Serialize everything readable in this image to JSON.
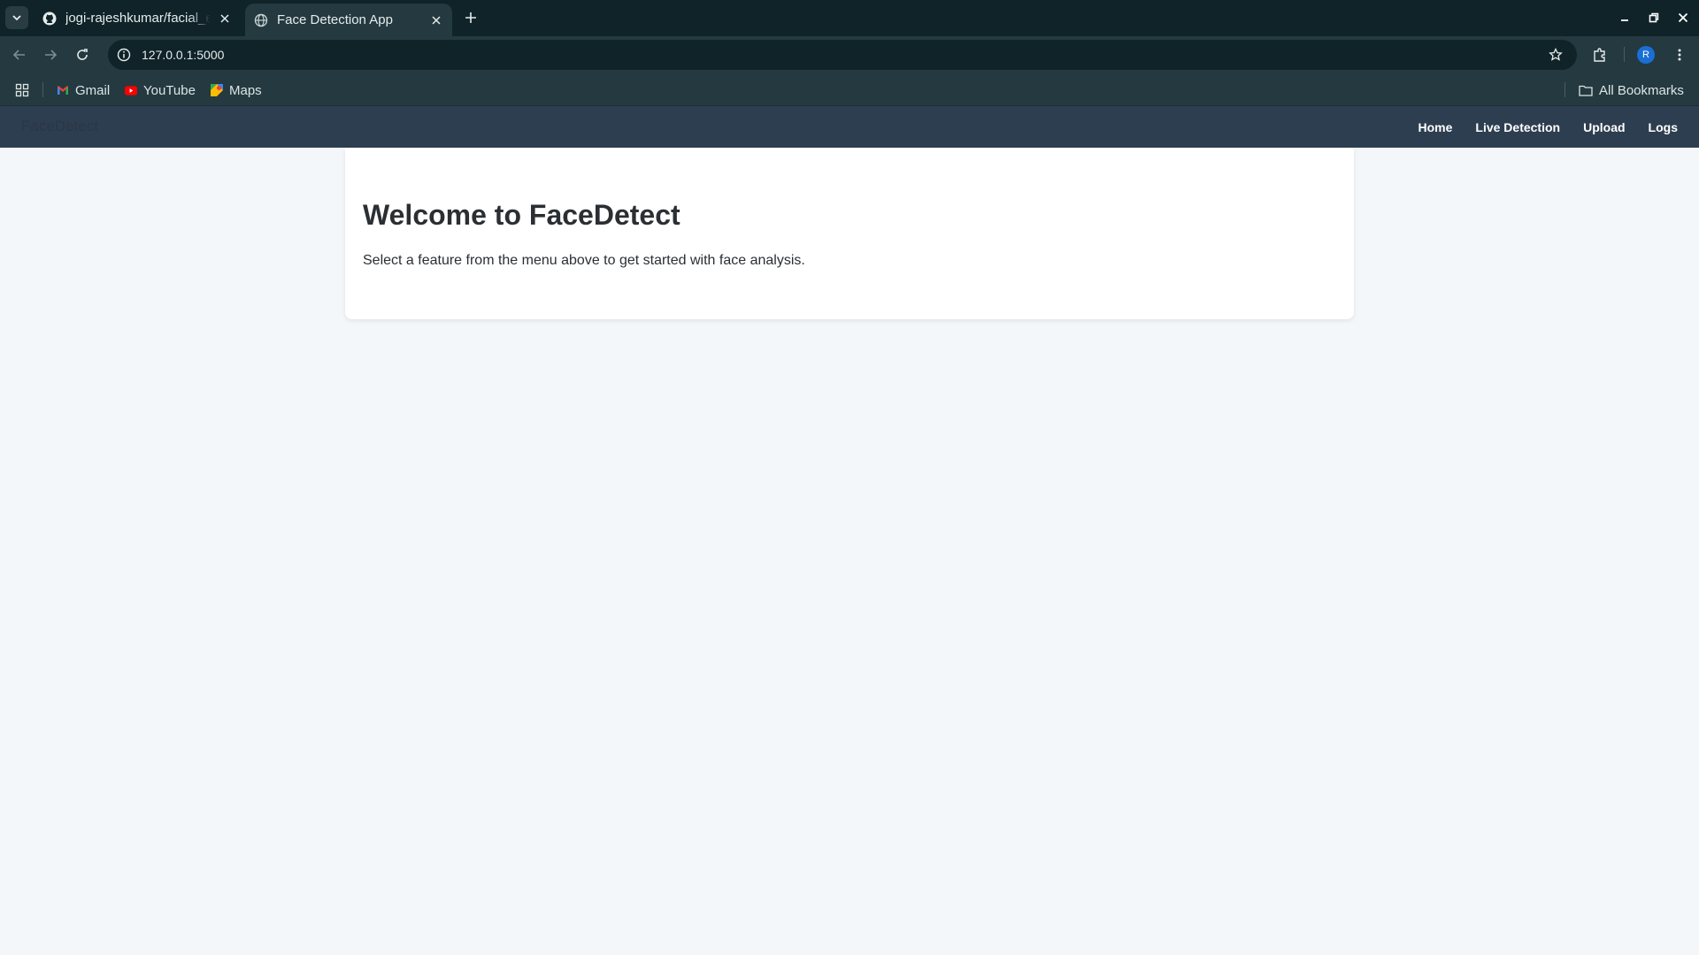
{
  "browser": {
    "tabs": [
      {
        "title": "jogi-rajeshkumar/facial_e",
        "icon": "github-icon"
      },
      {
        "title": "Face Detection App",
        "icon": "globe-icon"
      }
    ],
    "url": "127.0.0.1:5000",
    "profile_initial": "R",
    "bookmarks": [
      {
        "label": "Gmail",
        "icon": "gmail-icon"
      },
      {
        "label": "YouTube",
        "icon": "youtube-icon"
      },
      {
        "label": "Maps",
        "icon": "maps-icon"
      }
    ],
    "all_bookmarks_label": "All Bookmarks"
  },
  "app": {
    "brand": "FaceDetect",
    "nav": [
      "Home",
      "Live Detection",
      "Upload",
      "Logs"
    ],
    "nav_bg": "#2d3e50",
    "page_bg": "#f4f7fa"
  },
  "main": {
    "title": "Welcome to FaceDetect",
    "subtitle": "Select a feature from the menu above to get started with face analysis."
  }
}
